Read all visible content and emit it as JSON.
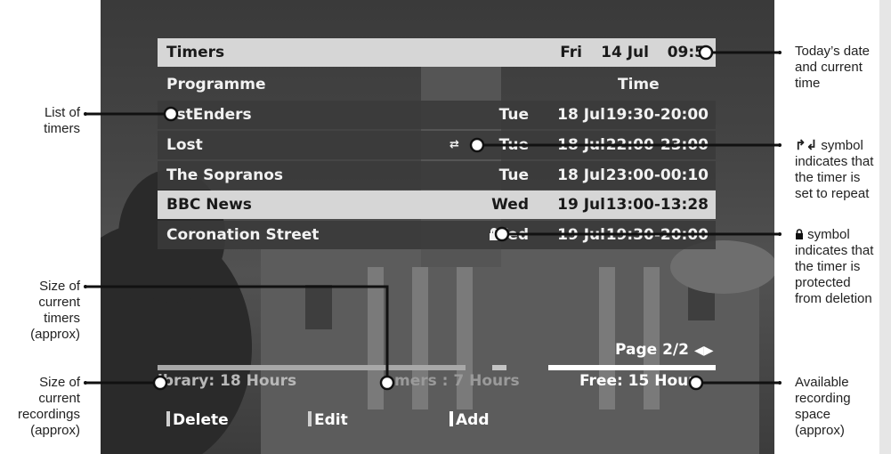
{
  "header": {
    "title": "Timers",
    "day": "Fri",
    "date": "14 Jul",
    "clock": "09:5"
  },
  "columns": {
    "programme": "Programme",
    "time": "Time"
  },
  "timers": [
    {
      "name": "astEnders",
      "day": "Tue",
      "date": "18 Jul",
      "time": "19:30-20:00",
      "flag": ""
    },
    {
      "name": "Lost",
      "day": "Tue",
      "date": "18 Jul",
      "time": "22:00-23:00",
      "flag": "repeat"
    },
    {
      "name": "The Sopranos",
      "day": "Tue",
      "date": "18 Jul",
      "time": "23:00-00:10",
      "flag": ""
    },
    {
      "name": "BBC News",
      "day": "Wed",
      "date": "19 Jul",
      "time": "13:00-13:28",
      "flag": "",
      "selected": true
    },
    {
      "name": "Coronation Street",
      "day": "Wed",
      "date": "19 Jul",
      "time": "19:30-20:00",
      "flag": "protected"
    }
  ],
  "pagination": {
    "label": "Page 2/2",
    "arrows": "◀▶"
  },
  "storage": {
    "library": "ibrary: 18 Hours",
    "timers": "mers : 7 Hours",
    "free": "Free: 15 Hour",
    "library_fraction": 0.6,
    "timers_fraction": 0.1,
    "free_fraction": 0.3
  },
  "keys": {
    "delete": "Delete",
    "edit": "Edit",
    "add": "Add"
  },
  "annotations": {
    "date_time": [
      "Today’s date",
      "and current",
      "time"
    ],
    "list": [
      "List of",
      "timers"
    ],
    "repeat": [
      "symbol",
      "indicates that",
      "the timer is",
      "set to repeat"
    ],
    "repeat_glyph": "↱↲",
    "protect": [
      "symbol",
      "indicates that",
      "the timer is",
      "protected",
      "from deletion"
    ],
    "size_timers": [
      "Size of",
      "current",
      "timers",
      "(approx)"
    ],
    "size_recordings": [
      "Size of",
      "current",
      "recordings",
      "(approx)"
    ],
    "available": [
      "Available",
      "recording",
      "space",
      "(approx)"
    ]
  },
  "icons": {
    "repeat": "repeat-icon",
    "lock": "lock-icon"
  },
  "colors": {
    "row_bg": "#3a3a3a",
    "highlight": "#d6d6d6",
    "free_bar": "#ffffff",
    "used_bar": "#a8a8a8"
  }
}
